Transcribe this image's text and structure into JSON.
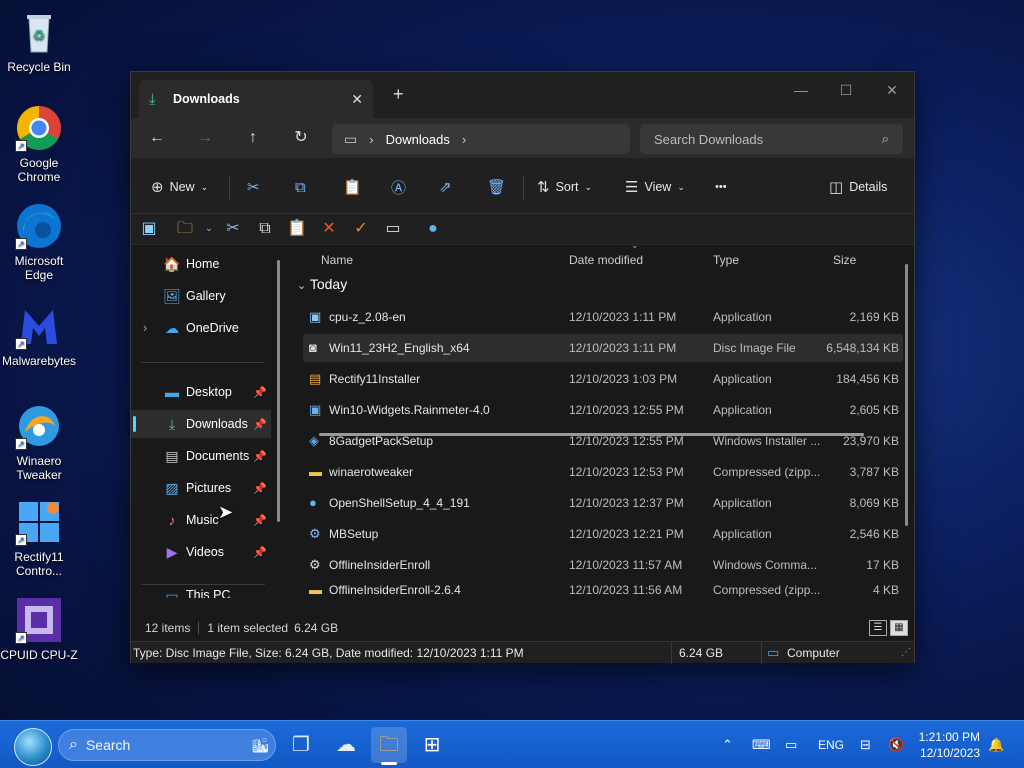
{
  "desktop": {
    "icons": [
      {
        "label": "Recycle Bin",
        "icon": "recycle-bin-icon"
      },
      {
        "label": "Google Chrome",
        "icon": "chrome-icon"
      },
      {
        "label": "Microsoft Edge",
        "icon": "edge-icon"
      },
      {
        "label": "Malwarebytes",
        "icon": "malwarebytes-icon"
      },
      {
        "label": "Winaero Tweaker",
        "icon": "winaero-icon"
      },
      {
        "label": "Rectify11 Contro...",
        "icon": "rectify11-icon"
      },
      {
        "label": "CPUID CPU-Z",
        "icon": "cpuz-icon"
      }
    ]
  },
  "window": {
    "tab_title": "Downloads",
    "new_tab": "+",
    "address": {
      "crumb": "Downloads",
      "chevron": "›"
    },
    "search_placeholder": "Search Downloads",
    "commands": {
      "new": "New",
      "sort": "Sort",
      "view": "View",
      "more": "•••",
      "details": "Details"
    },
    "nav": {
      "home": "Home",
      "gallery": "Gallery",
      "onedrive": "OneDrive",
      "desktop": "Desktop",
      "downloads": "Downloads",
      "documents": "Documents",
      "pictures": "Pictures",
      "music": "Music",
      "videos": "Videos",
      "thispc": "This PC"
    },
    "columns": {
      "name": "Name",
      "date": "Date modified",
      "type": "Type",
      "size": "Size"
    },
    "group": "Today",
    "files": [
      {
        "name": "cpu-z_2.08-en",
        "date": "12/10/2023 1:11 PM",
        "type": "Application",
        "size": "2,169 KB",
        "icon": "app-icon"
      },
      {
        "name": "Win11_23H2_English_x64",
        "date": "12/10/2023 1:11 PM",
        "type": "Disc Image File",
        "size": "6,548,134 KB",
        "icon": "disc-image-icon"
      },
      {
        "name": "Rectify11Installer",
        "date": "12/10/2023 1:03 PM",
        "type": "Application",
        "size": "184,456 KB",
        "icon": "app-icon"
      },
      {
        "name": "Win10-Widgets.Rainmeter-4.0",
        "date": "12/10/2023 12:55 PM",
        "type": "Application",
        "size": "2,605 KB",
        "icon": "app-icon"
      },
      {
        "name": "8GadgetPackSetup",
        "date": "12/10/2023 12:55 PM",
        "type": "Windows Installer ...",
        "size": "23,970 KB",
        "icon": "installer-icon"
      },
      {
        "name": "winaerotweaker",
        "date": "12/10/2023 12:53 PM",
        "type": "Compressed (zipp...",
        "size": "3,787 KB",
        "icon": "zip-folder-icon"
      },
      {
        "name": "OpenShellSetup_4_4_191",
        "date": "12/10/2023 12:37 PM",
        "type": "Application",
        "size": "8,069 KB",
        "icon": "shell-icon"
      },
      {
        "name": "MBSetup",
        "date": "12/10/2023 12:21 PM",
        "type": "Application",
        "size": "2,546 KB",
        "icon": "mb-icon"
      },
      {
        "name": "OfflineInsiderEnroll",
        "date": "12/10/2023 11:57 AM",
        "type": "Windows Comma...",
        "size": "17 KB",
        "icon": "cmd-file-icon"
      },
      {
        "name": "OfflineInsiderEnroll-2.6.4",
        "date": "12/10/2023 11:56 AM",
        "type": "Compressed (zipp...",
        "size": "4 KB",
        "icon": "zip-folder-icon"
      }
    ],
    "status": {
      "items": "12 items",
      "selected": "1 item selected",
      "selected_size": "6.24 GB"
    },
    "classic_status": {
      "info": "Type: Disc Image File, Size: 6.24 GB, Date modified: 12/10/2023 1:11 PM",
      "size": "6.24 GB",
      "zone": "Computer"
    }
  },
  "taskbar": {
    "search": "Search",
    "lang": "ENG",
    "time": "1:21:00 PM",
    "date": "12/10/2023"
  },
  "colors": {
    "accent": "#60cdff",
    "taskbar": "#1a6ad8",
    "window_bg": "#191919"
  }
}
